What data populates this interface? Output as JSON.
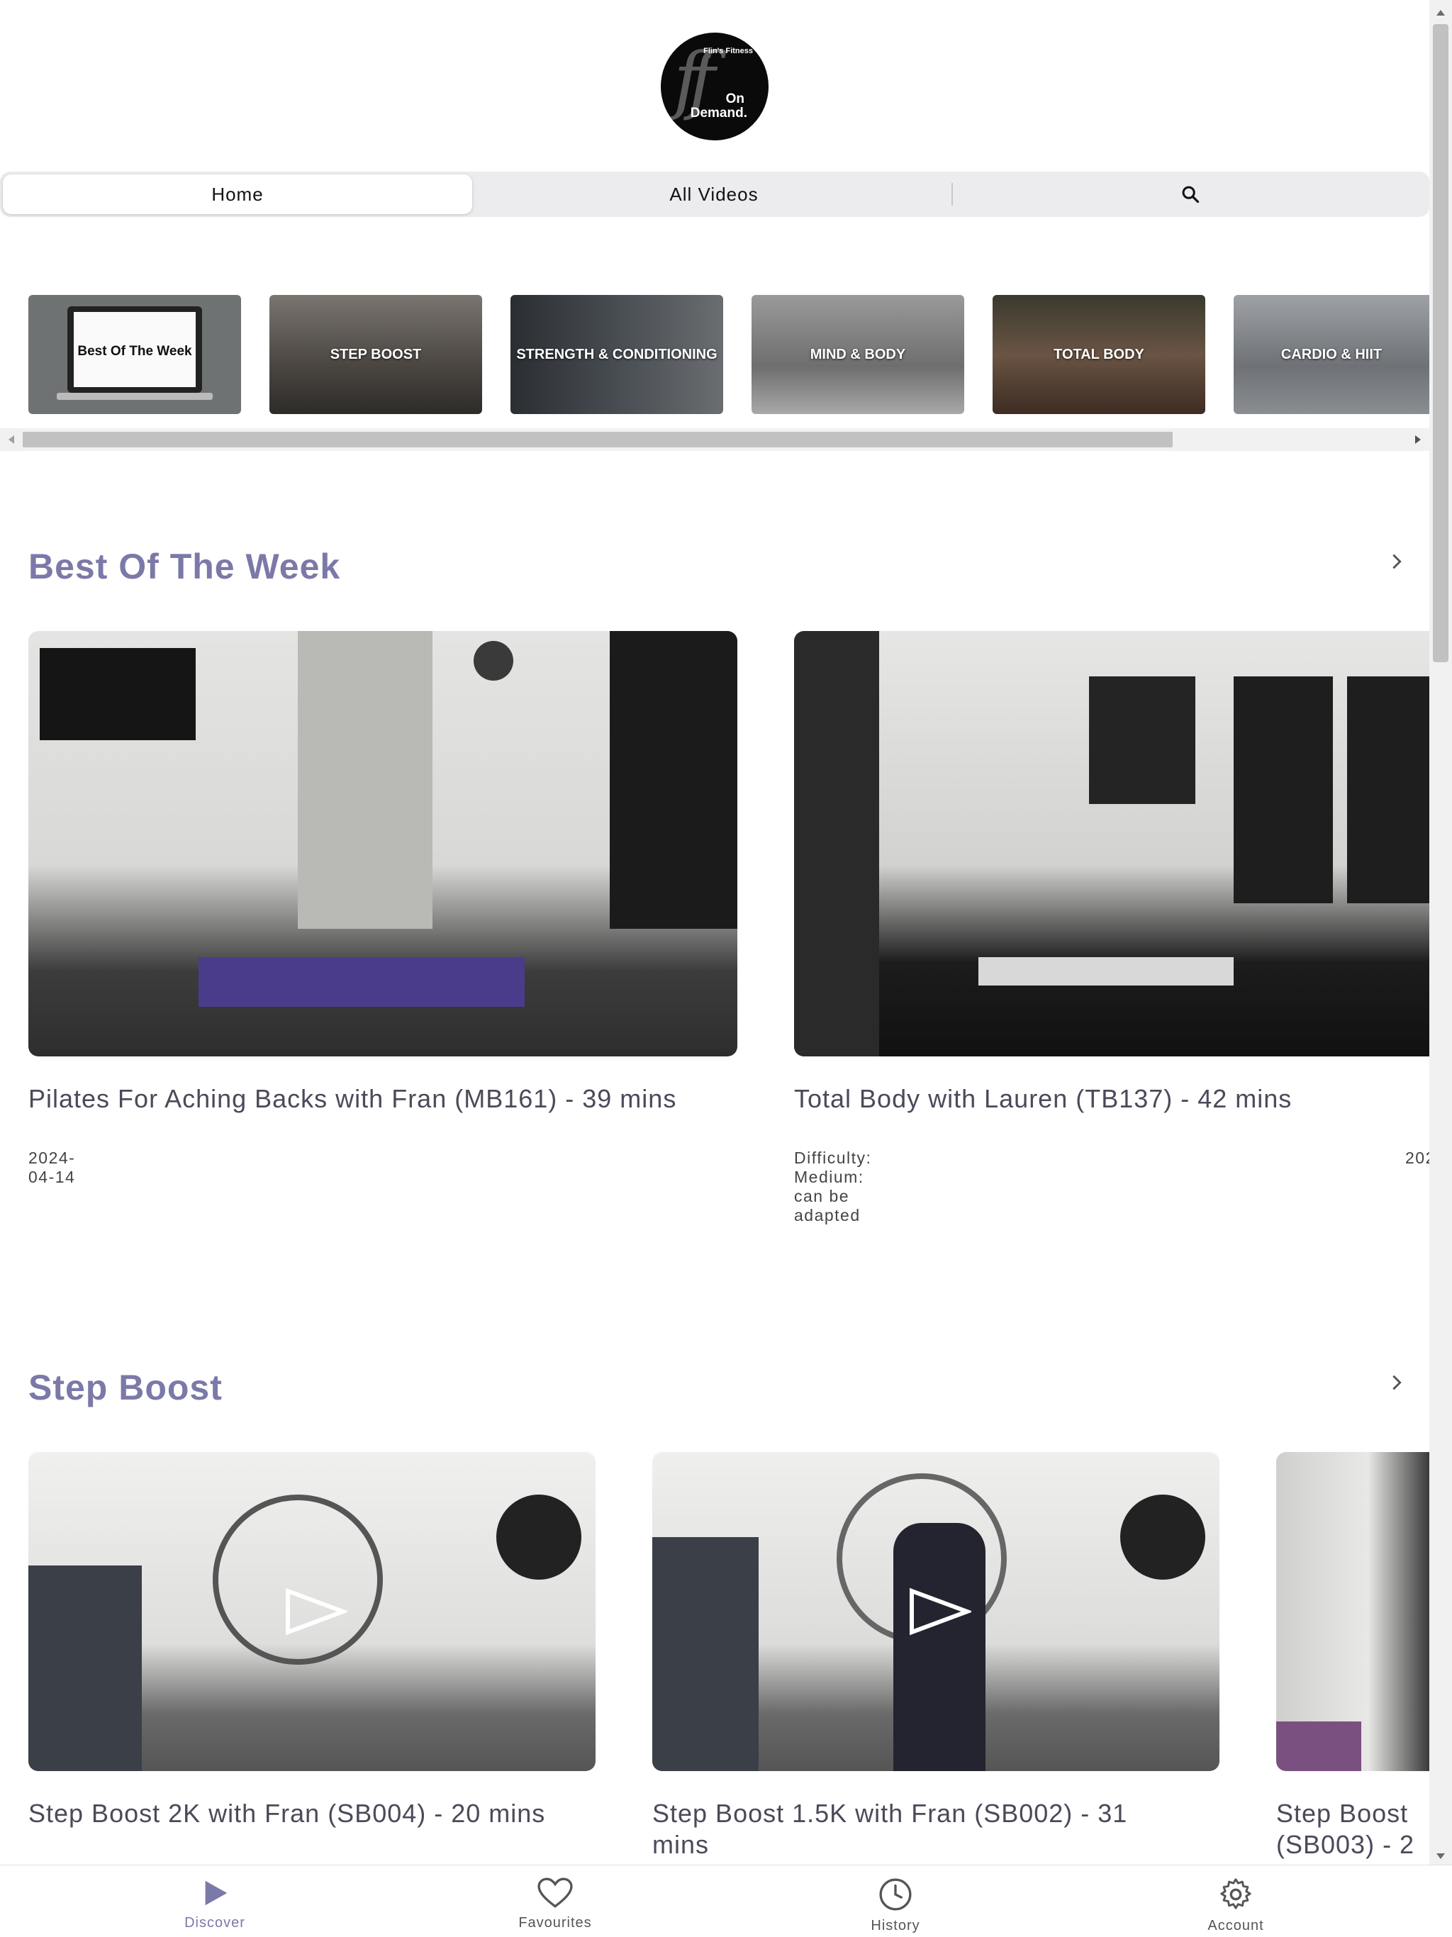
{
  "brand": {
    "logo_small": "Flin's Fitness",
    "logo_line1": "On",
    "logo_line2": "Demand."
  },
  "tabs": [
    {
      "label": "Home",
      "active": true
    },
    {
      "label": "All Videos",
      "active": false
    }
  ],
  "search": {
    "icon": "search-icon"
  },
  "categories": [
    {
      "label": "Best Of The Week",
      "color": "#6f7273"
    },
    {
      "label": "STEP BOOST",
      "color": "#5a5550"
    },
    {
      "label": "STRENGTH & CONDITIONING",
      "color": "#3f4448"
    },
    {
      "label": "MIND & BODY",
      "color": "#8a8a8a"
    },
    {
      "label": "TOTAL BODY",
      "color": "#5a4a3a"
    },
    {
      "label": "CARDIO & HIIT",
      "color": "#7c7f84"
    }
  ],
  "sections": [
    {
      "title": "Best Of The Week",
      "videos": [
        {
          "title": "Pilates For Aching Backs with Fran (MB161) - 39 mins",
          "meta": "2024-04-14"
        },
        {
          "title": "Total Body with Lauren (TB137) - 42 mins",
          "meta": "Difficulty: Medium: can be adapted",
          "meta_clipped": "202"
        }
      ]
    },
    {
      "title": "Step Boost",
      "videos": [
        {
          "title": "Step Boost 2K with Fran (SB004) - 20 mins"
        },
        {
          "title": "Step Boost 1.5K with Fran (SB002) - 31 mins"
        },
        {
          "title": "Step Boost (SB003) - 2"
        }
      ]
    }
  ],
  "bottom_nav": [
    {
      "label": "Discover",
      "icon": "play-icon",
      "active": true
    },
    {
      "label": "Favourites",
      "icon": "heart-icon",
      "active": false
    },
    {
      "label": "History",
      "icon": "clock-icon",
      "active": false
    },
    {
      "label": "Account",
      "icon": "gear-icon",
      "active": false
    }
  ],
  "colors": {
    "accent": "#7b79a8",
    "tabbar": "#ececef"
  }
}
